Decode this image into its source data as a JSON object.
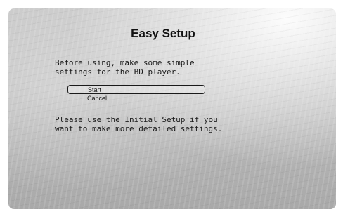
{
  "dialog": {
    "title": "Easy Setup",
    "intro_lines": [
      "Before using, make some simple",
      "settings for the BD player."
    ],
    "options": [
      {
        "label": "Start",
        "selected": true
      },
      {
        "label": "Cancel",
        "selected": false
      }
    ],
    "note_lines": [
      "Please use the Initial Setup if you",
      "want to make more detailed settings."
    ]
  }
}
